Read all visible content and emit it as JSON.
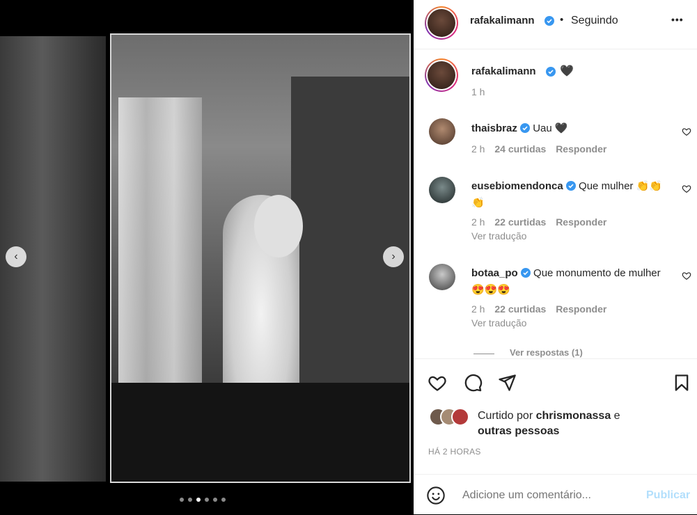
{
  "post": {
    "carousel_dots": 6,
    "active_dot": 3
  },
  "header": {
    "username": "rafakalimann",
    "separator": "•",
    "follow_status": "Seguindo",
    "more_label": "•••"
  },
  "caption": {
    "username": "rafakalimann",
    "text": "🖤",
    "time": "1 h"
  },
  "comments": [
    {
      "username": "thaisbraz",
      "text": "Uau 🖤",
      "time": "2 h",
      "likes": "24 curtidas",
      "reply": "Responder",
      "translate": ""
    },
    {
      "username": "eusebiomendonca",
      "text": "Que mulher 👏👏👏",
      "time": "2 h",
      "likes": "22 curtidas",
      "reply": "Responder",
      "translate": "Ver tradução"
    },
    {
      "username": "botaa_po",
      "text": "Que monumento de mulher 😍😍😍",
      "time": "2 h",
      "likes": "22 curtidas",
      "reply": "Responder",
      "translate": "Ver tradução"
    }
  ],
  "view_replies": "Ver respostas (1)",
  "likes": {
    "prefix": "Curtido por",
    "user": "chrismonassa",
    "conj": "e",
    "others": "outras pessoas"
  },
  "timestamp": "HÁ 2 HORAS",
  "add_comment": {
    "placeholder": "Adicione um comentário...",
    "publish": "Publicar"
  }
}
